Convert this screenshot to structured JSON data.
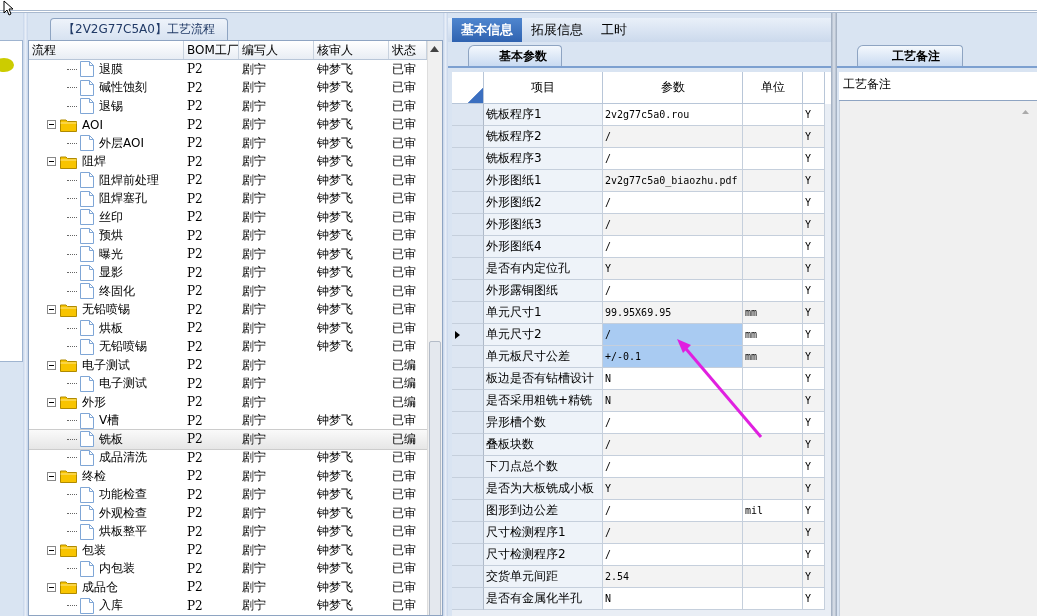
{
  "tree_panel": {
    "tab": "【2V2G77C5A0】工艺流程",
    "columns": [
      "流程",
      "BOM工厂",
      "编写人",
      "核审人",
      "状态"
    ],
    "rows": [
      {
        "children": [
          {
            "label": "退膜",
            "bom": "P2",
            "author": "剧宁",
            "reviewer": "钟梦飞",
            "status": "已审",
            "selected": false
          },
          {
            "label": "碱性蚀刻",
            "bom": "P2",
            "author": "剧宁",
            "reviewer": "钟梦飞",
            "status": "已审",
            "selected": false
          },
          {
            "label": "退锡",
            "bom": "P2",
            "author": "剧宁",
            "reviewer": "钟梦飞",
            "status": "已审",
            "selected": false
          }
        ]
      },
      {
        "label": "AOI",
        "bom": "P2",
        "author": "剧宁",
        "reviewer": "钟梦飞",
        "status": "已审",
        "selected": false,
        "expanded": true,
        "children": [
          {
            "label": "外层AOI",
            "bom": "P2",
            "author": "剧宁",
            "reviewer": "钟梦飞",
            "status": "已审",
            "selected": false
          }
        ]
      },
      {
        "label": "阻焊",
        "bom": "P2",
        "author": "剧宁",
        "reviewer": "钟梦飞",
        "status": "已审",
        "selected": false,
        "expanded": true,
        "children": [
          {
            "label": "阻焊前处理",
            "bom": "P2",
            "author": "剧宁",
            "reviewer": "钟梦飞",
            "status": "已审",
            "selected": false
          },
          {
            "label": "阻焊塞孔",
            "bom": "P2",
            "author": "剧宁",
            "reviewer": "钟梦飞",
            "status": "已审",
            "selected": false
          },
          {
            "label": "丝印",
            "bom": "P2",
            "author": "剧宁",
            "reviewer": "钟梦飞",
            "status": "已审",
            "selected": false
          },
          {
            "label": "预烘",
            "bom": "P2",
            "author": "剧宁",
            "reviewer": "钟梦飞",
            "status": "已审",
            "selected": false
          },
          {
            "label": "曝光",
            "bom": "P2",
            "author": "剧宁",
            "reviewer": "钟梦飞",
            "status": "已审",
            "selected": false
          },
          {
            "label": "显影",
            "bom": "P2",
            "author": "剧宁",
            "reviewer": "钟梦飞",
            "status": "已审",
            "selected": false
          },
          {
            "label": "终固化",
            "bom": "P2",
            "author": "剧宁",
            "reviewer": "钟梦飞",
            "status": "已审",
            "selected": false
          }
        ]
      },
      {
        "label": "无铅喷锡",
        "bom": "P2",
        "author": "剧宁",
        "reviewer": "钟梦飞",
        "status": "已审",
        "selected": false,
        "expanded": true,
        "children": [
          {
            "label": "烘板",
            "bom": "P2",
            "author": "剧宁",
            "reviewer": "钟梦飞",
            "status": "已审",
            "selected": false
          },
          {
            "label": "无铅喷锡",
            "bom": "P2",
            "author": "剧宁",
            "reviewer": "钟梦飞",
            "status": "已审",
            "selected": false
          }
        ]
      },
      {
        "label": "电子测试",
        "bom": "P2",
        "author": "剧宁",
        "status": "已编",
        "selected": false,
        "expanded": true,
        "children": [
          {
            "label": "电子测试",
            "bom": "P2",
            "author": "剧宁",
            "status": "已编",
            "selected": false
          }
        ]
      },
      {
        "label": "外形",
        "bom": "P2",
        "author": "剧宁",
        "status": "已编",
        "selected": false,
        "expanded": true,
        "children": [
          {
            "label": "V槽",
            "bom": "P2",
            "author": "剧宁",
            "reviewer": "钟梦飞",
            "status": "已审",
            "selected": false
          },
          {
            "label": "铣板",
            "bom": "P2",
            "author": "剧宁",
            "status": "已编",
            "selected": true
          },
          {
            "label": "成品清洗",
            "bom": "P2",
            "author": "剧宁",
            "reviewer": "钟梦飞",
            "status": "已审",
            "selected": false
          }
        ]
      },
      {
        "label": "终检",
        "bom": "P2",
        "author": "剧宁",
        "reviewer": "钟梦飞",
        "status": "已审",
        "selected": false,
        "expanded": true,
        "children": [
          {
            "label": "功能检查",
            "bom": "P2",
            "author": "剧宁",
            "reviewer": "钟梦飞",
            "status": "已审",
            "selected": false
          },
          {
            "label": "外观检查",
            "bom": "P2",
            "author": "剧宁",
            "reviewer": "钟梦飞",
            "status": "已审",
            "selected": false
          },
          {
            "label": "烘板整平",
            "bom": "P2",
            "author": "剧宁",
            "reviewer": "钟梦飞",
            "status": "已审",
            "selected": false
          }
        ]
      },
      {
        "label": "包装",
        "bom": "P2",
        "author": "剧宁",
        "reviewer": "钟梦飞",
        "status": "已审",
        "selected": false,
        "expanded": true,
        "children": [
          {
            "label": "内包装",
            "bom": "P2",
            "author": "剧宁",
            "reviewer": "钟梦飞",
            "status": "已审",
            "selected": false
          }
        ]
      },
      {
        "label": "成品仓",
        "bom": "P2",
        "author": "剧宁",
        "reviewer": "钟梦飞",
        "status": "已审",
        "selected": false,
        "expanded": true,
        "children": [
          {
            "label": "入库",
            "bom": "P2",
            "author": "剧宁",
            "reviewer": "钟梦飞",
            "status": "已审",
            "selected": false
          }
        ]
      }
    ]
  },
  "main_panel": {
    "tabs": [
      {
        "label": "基本信息",
        "selected": true
      },
      {
        "label": "拓展信息",
        "selected": false
      },
      {
        "label": "工时",
        "selected": false
      }
    ],
    "subtab": "基本参数",
    "columns": [
      "项目",
      "参数",
      "单位"
    ],
    "rows": [
      {
        "item": "铣板程序1",
        "value": "2v2g77c5a0.rou",
        "column_4": "Y",
        "selected": false,
        "current": false
      },
      {
        "item": "铣板程序2",
        "value": "/",
        "column_4": "Y",
        "selected": false,
        "current": false
      },
      {
        "item": "铣板程序3",
        "value": "/",
        "column_4": "Y",
        "selected": false,
        "current": false
      },
      {
        "item": "外形图纸1",
        "value": "2v2g77c5a0_biaozhu.pdf",
        "column_4": "Y",
        "selected": false,
        "current": false
      },
      {
        "item": "外形图纸2",
        "value": "/",
        "column_4": "Y",
        "selected": false,
        "current": false
      },
      {
        "item": "外形图纸3",
        "value": "/",
        "column_4": "Y",
        "selected": false,
        "current": false
      },
      {
        "item": "外形图纸4",
        "value": "/",
        "column_4": "Y",
        "selected": false,
        "current": false
      },
      {
        "item": "是否有内定位孔",
        "value": "Y",
        "column_4": "Y",
        "selected": false,
        "current": false
      },
      {
        "item": "外形露铜图纸",
        "value": "/",
        "column_4": "Y",
        "selected": false,
        "current": false
      },
      {
        "item": "单元尺寸1",
        "value": "99.95X69.95",
        "unit": "mm",
        "column_4": "Y",
        "selected": false,
        "current": false
      },
      {
        "item": "单元尺寸2",
        "value": "/",
        "unit": "mm",
        "column_4": "Y",
        "selected": true,
        "current": true
      },
      {
        "item": "单元板尺寸公差",
        "value": "+/-0.1",
        "unit": "mm",
        "column_4": "Y",
        "selected": true,
        "current": false
      },
      {
        "item": "板边是否有钻槽设计",
        "value": "N",
        "column_4": "Y",
        "selected": false,
        "current": false
      },
      {
        "item": "是否采用粗铣+精铣",
        "value": "N",
        "column_4": "Y",
        "selected": false,
        "current": false
      },
      {
        "item": "异形槽个数",
        "value": "/",
        "column_4": "Y",
        "selected": false,
        "current": false
      },
      {
        "item": "叠板块数",
        "value": "/",
        "column_4": "Y",
        "selected": false,
        "current": false
      },
      {
        "item": "下刀点总个数",
        "value": "/",
        "column_4": "Y",
        "selected": false,
        "current": false
      },
      {
        "item": "是否为大板铣成小板",
        "value": "Y",
        "column_4": "Y",
        "selected": false,
        "current": false
      },
      {
        "item": "图形到边公差",
        "value": "/",
        "unit": "mil",
        "column_4": "Y",
        "selected": false,
        "current": false
      },
      {
        "item": "尺寸检测程序1",
        "value": "/",
        "column_4": "Y",
        "selected": false,
        "current": false
      },
      {
        "item": "尺寸检测程序2",
        "value": "/",
        "column_4": "Y",
        "selected": false,
        "current": false
      },
      {
        "item": "交货单元间距",
        "value": "2.54",
        "column_4": "Y",
        "selected": false,
        "current": false
      },
      {
        "item": "是否有金属化半孔",
        "value": "N",
        "column_4": "Y",
        "selected": false,
        "current": false
      }
    ],
    "annotations": [
      {
        "kind": "arrow"
      }
    ]
  },
  "notes_panel": {
    "tab": "工艺备注",
    "header": "工艺备注"
  }
}
